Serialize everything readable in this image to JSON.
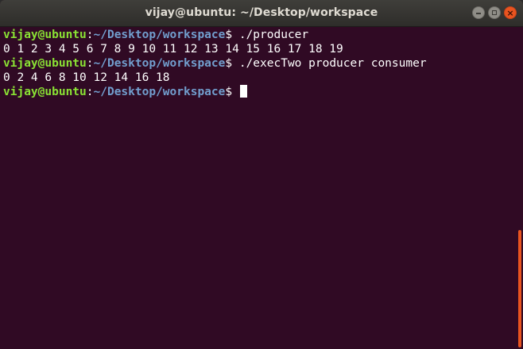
{
  "window": {
    "title": "vijay@ubuntu: ~/Desktop/workspace",
    "buttons": {
      "minimize": "minimize-icon",
      "maximize": "maximize-icon",
      "close": "close-icon"
    }
  },
  "terminal": {
    "prompt_user": "vijay@ubuntu",
    "prompt_sep": ":",
    "prompt_path": "~/Desktop/workspace",
    "prompt_symbol": "$ ",
    "lines": [
      {
        "type": "prompt",
        "command": "./producer"
      },
      {
        "type": "output",
        "text": "0 1 2 3 4 5 6 7 8 9 10 11 12 13 14 15 16 17 18 19"
      },
      {
        "type": "prompt",
        "command": "./execTwo producer consumer"
      },
      {
        "type": "output",
        "text": "0 2 4 6 8 10 12 14 16 18"
      },
      {
        "type": "prompt",
        "command": ""
      }
    ]
  },
  "colors": {
    "background": "#300a24",
    "user": "#8ae234",
    "path": "#729fcf",
    "accent": "#e95420"
  }
}
